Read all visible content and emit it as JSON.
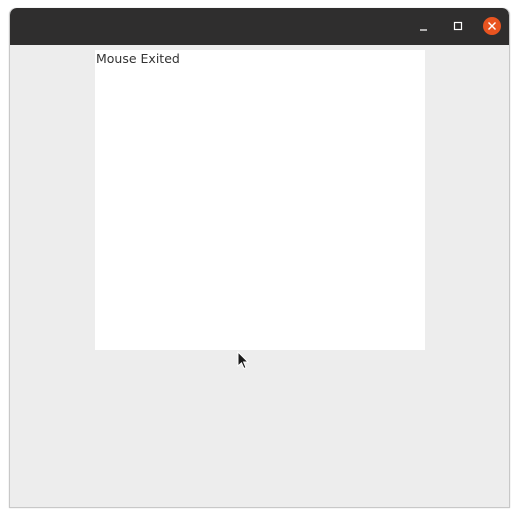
{
  "titlebar": {
    "minimize_icon": "minimize-icon",
    "maximize_icon": "maximize-icon",
    "close_icon": "close-icon",
    "close_color": "#e95420",
    "background_color": "#2f2e2e"
  },
  "panel": {
    "status_text": "Mouse Exited",
    "background_color": "#ffffff"
  },
  "window": {
    "background_color": "#ededed"
  },
  "cursor": {
    "icon": "mouse-pointer-icon"
  }
}
